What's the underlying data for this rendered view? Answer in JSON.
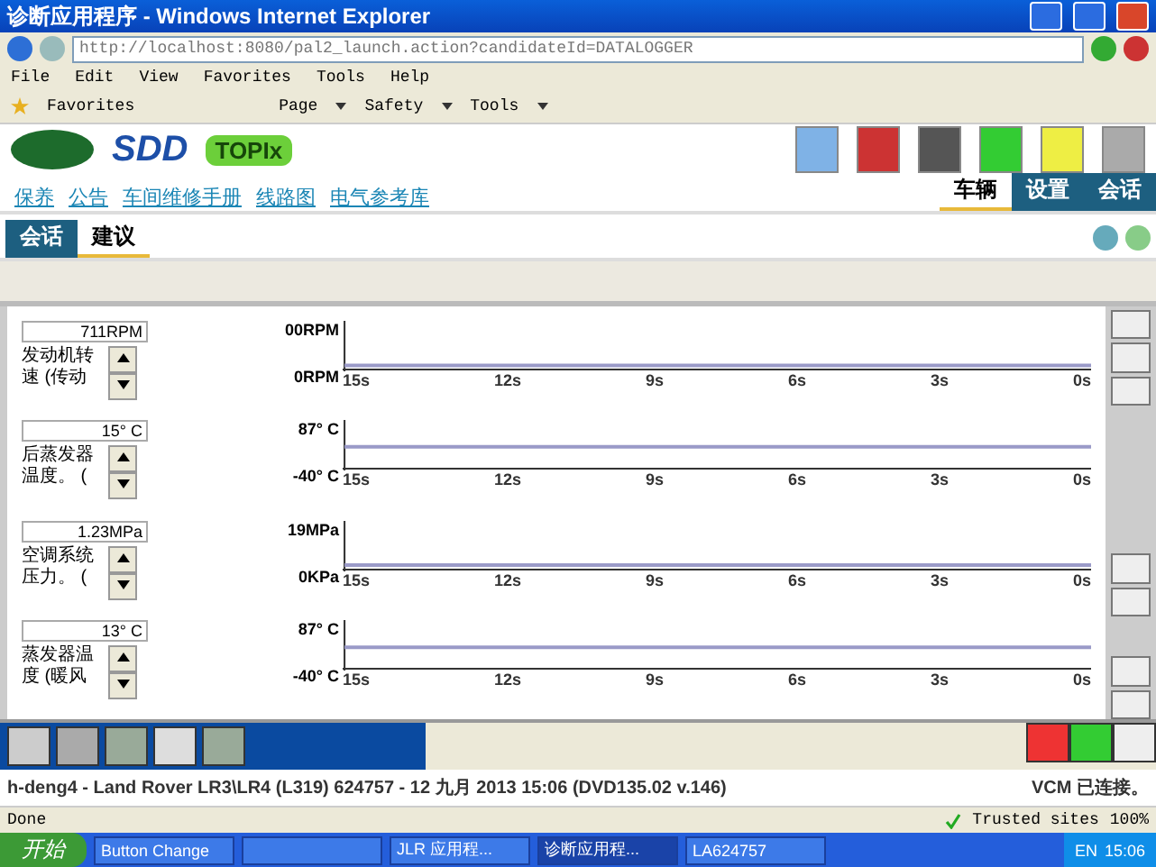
{
  "window": {
    "title": "诊断应用程序 - Windows Internet Explorer"
  },
  "address": {
    "value": "http://localhost:8080/pal2_launch.action?candidateId=DATALOGGER"
  },
  "menu": [
    "File",
    "Edit",
    "View",
    "Favorites",
    "Tools",
    "Help"
  ],
  "command_bar": {
    "favorites": "Favorites",
    "items": [
      "Page",
      "Safety",
      "Tools"
    ]
  },
  "brand": {
    "sdd": "SDD",
    "topix": "TOPIx"
  },
  "nav_links": [
    "保养",
    "公告",
    "车间维修手册",
    "线路图",
    "电气参考库"
  ],
  "main_tabs": [
    {
      "label": "车辆",
      "selected": true
    },
    {
      "label": "设置",
      "selected": false
    },
    {
      "label": "会话",
      "selected": false
    }
  ],
  "sub_tabs": [
    {
      "label": "会话",
      "selected": false
    },
    {
      "label": "建议",
      "selected": true
    }
  ],
  "channels": [
    {
      "reading": "711RPM",
      "name": "发动机转速 (传动",
      "y_top": "00RPM",
      "y_bottom": "0RPM",
      "time_ticks": [
        "15s",
        "12s",
        "9s",
        "6s",
        "3s",
        "0s"
      ]
    },
    {
      "reading": "15° C",
      "name": "后蒸发器温度。 (",
      "y_top": "87° C",
      "y_bottom": "-40° C",
      "time_ticks": [
        "15s",
        "12s",
        "9s",
        "6s",
        "3s",
        "0s"
      ]
    },
    {
      "reading": "1.23MPa",
      "name": "空调系统压力。 (",
      "y_top": "19MPa",
      "y_bottom": "0KPa",
      "time_ticks": [
        "15s",
        "12s",
        "9s",
        "6s",
        "3s",
        "0s"
      ]
    },
    {
      "reading": "13° C",
      "name": "蒸发器温度 (暖风",
      "y_top": "87° C",
      "y_bottom": "-40° C",
      "time_ticks": [
        "15s",
        "12s",
        "9s",
        "6s",
        "3s",
        "0s"
      ]
    }
  ],
  "session_status": {
    "text": "h-deng4 - Land Rover LR3\\LR4 (L319) 624757 - 12 九月 2013 15:06 (DVD135.02 v.146)",
    "vcm": "VCM 已连接。"
  },
  "ie_status": {
    "text": "Done",
    "zone": "Trusted sites",
    "zoom": "100%"
  },
  "taskbar": {
    "start": "开始",
    "tasks": [
      {
        "label": "Button Change",
        "selected": false
      },
      {
        "selected": false
      },
      {
        "label": "JLR 应用程...",
        "selected": false
      },
      {
        "label": "诊断应用程...",
        "selected": true
      },
      {
        "label": "LA624757",
        "selected": false
      }
    ],
    "lang": "EN",
    "clock": "15:06"
  }
}
